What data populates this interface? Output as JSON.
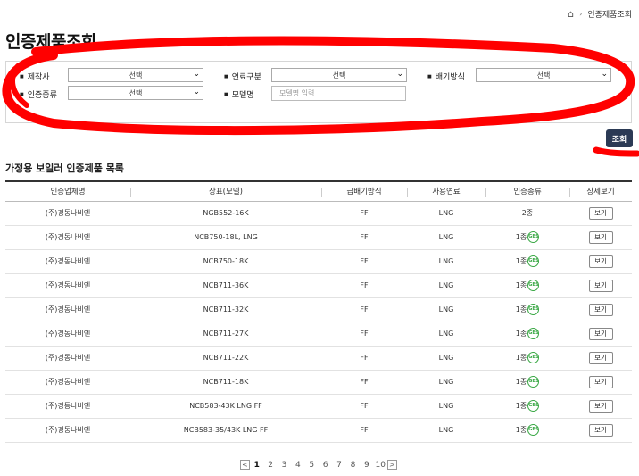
{
  "breadcrumb": {
    "home_icon": "home-icon",
    "separator": "›",
    "current": "인증제품조회"
  },
  "page_title": "인증제품조회",
  "filters": {
    "manufacturer": {
      "label": "제작사",
      "value": "선택"
    },
    "fuel_type": {
      "label": "연료구분",
      "value": "선택"
    },
    "exhaust_type": {
      "label": "배기방식",
      "value": "선택"
    },
    "cert_type": {
      "label": "인증종류",
      "value": "선택"
    },
    "model_name": {
      "label": "모델명",
      "placeholder": "모델명 입력"
    }
  },
  "search_button": "조회",
  "annotation_color": "#ff0000",
  "list_title": "가정용 보일러 인증제품 목록",
  "table": {
    "headers": [
      "인증업체명",
      "상표(모델)",
      "급배기방식",
      "사용연료",
      "인증종류",
      "상세보기"
    ],
    "rows": [
      {
        "company": "(주)경동나비엔",
        "model": "NGB552-16K",
        "exhaust": "FF",
        "fuel": "LNG",
        "cert": "2종",
        "badge": false,
        "view": "보기"
      },
      {
        "company": "(주)경동나비엔",
        "model": "NCB750-18L, LNG",
        "exhaust": "FF",
        "fuel": "LNG",
        "cert": "1종",
        "badge": true,
        "view": "보기"
      },
      {
        "company": "(주)경동나비엔",
        "model": "NCB750-18K",
        "exhaust": "FF",
        "fuel": "LNG",
        "cert": "1종",
        "badge": true,
        "view": "보기"
      },
      {
        "company": "(주)경동나비엔",
        "model": "NCB711-36K",
        "exhaust": "FF",
        "fuel": "LNG",
        "cert": "1종",
        "badge": true,
        "view": "보기"
      },
      {
        "company": "(주)경동나비엔",
        "model": "NCB711-32K",
        "exhaust": "FF",
        "fuel": "LNG",
        "cert": "1종",
        "badge": true,
        "view": "보기"
      },
      {
        "company": "(주)경동나비엔",
        "model": "NCB711-27K",
        "exhaust": "FF",
        "fuel": "LNG",
        "cert": "1종",
        "badge": true,
        "view": "보기"
      },
      {
        "company": "(주)경동나비엔",
        "model": "NCB711-22K",
        "exhaust": "FF",
        "fuel": "LNG",
        "cert": "1종",
        "badge": true,
        "view": "보기"
      },
      {
        "company": "(주)경동나비엔",
        "model": "NCB711-18K",
        "exhaust": "FF",
        "fuel": "LNG",
        "cert": "1종",
        "badge": true,
        "view": "보기"
      },
      {
        "company": "(주)경동나비엔",
        "model": "NCB583-43K LNG FF",
        "exhaust": "FF",
        "fuel": "LNG",
        "cert": "1종",
        "badge": true,
        "view": "보기"
      },
      {
        "company": "(주)경동나비엔",
        "model": "NCB583-35/43K LNG FF",
        "exhaust": "FF",
        "fuel": "LNG",
        "cert": "1종",
        "badge": true,
        "view": "보기"
      }
    ],
    "badge_text": "GBS"
  },
  "pagination": {
    "prev": "<",
    "next": ">",
    "pages": [
      "1",
      "2",
      "3",
      "4",
      "5",
      "6",
      "7",
      "8",
      "9",
      "10"
    ],
    "current": "1"
  }
}
